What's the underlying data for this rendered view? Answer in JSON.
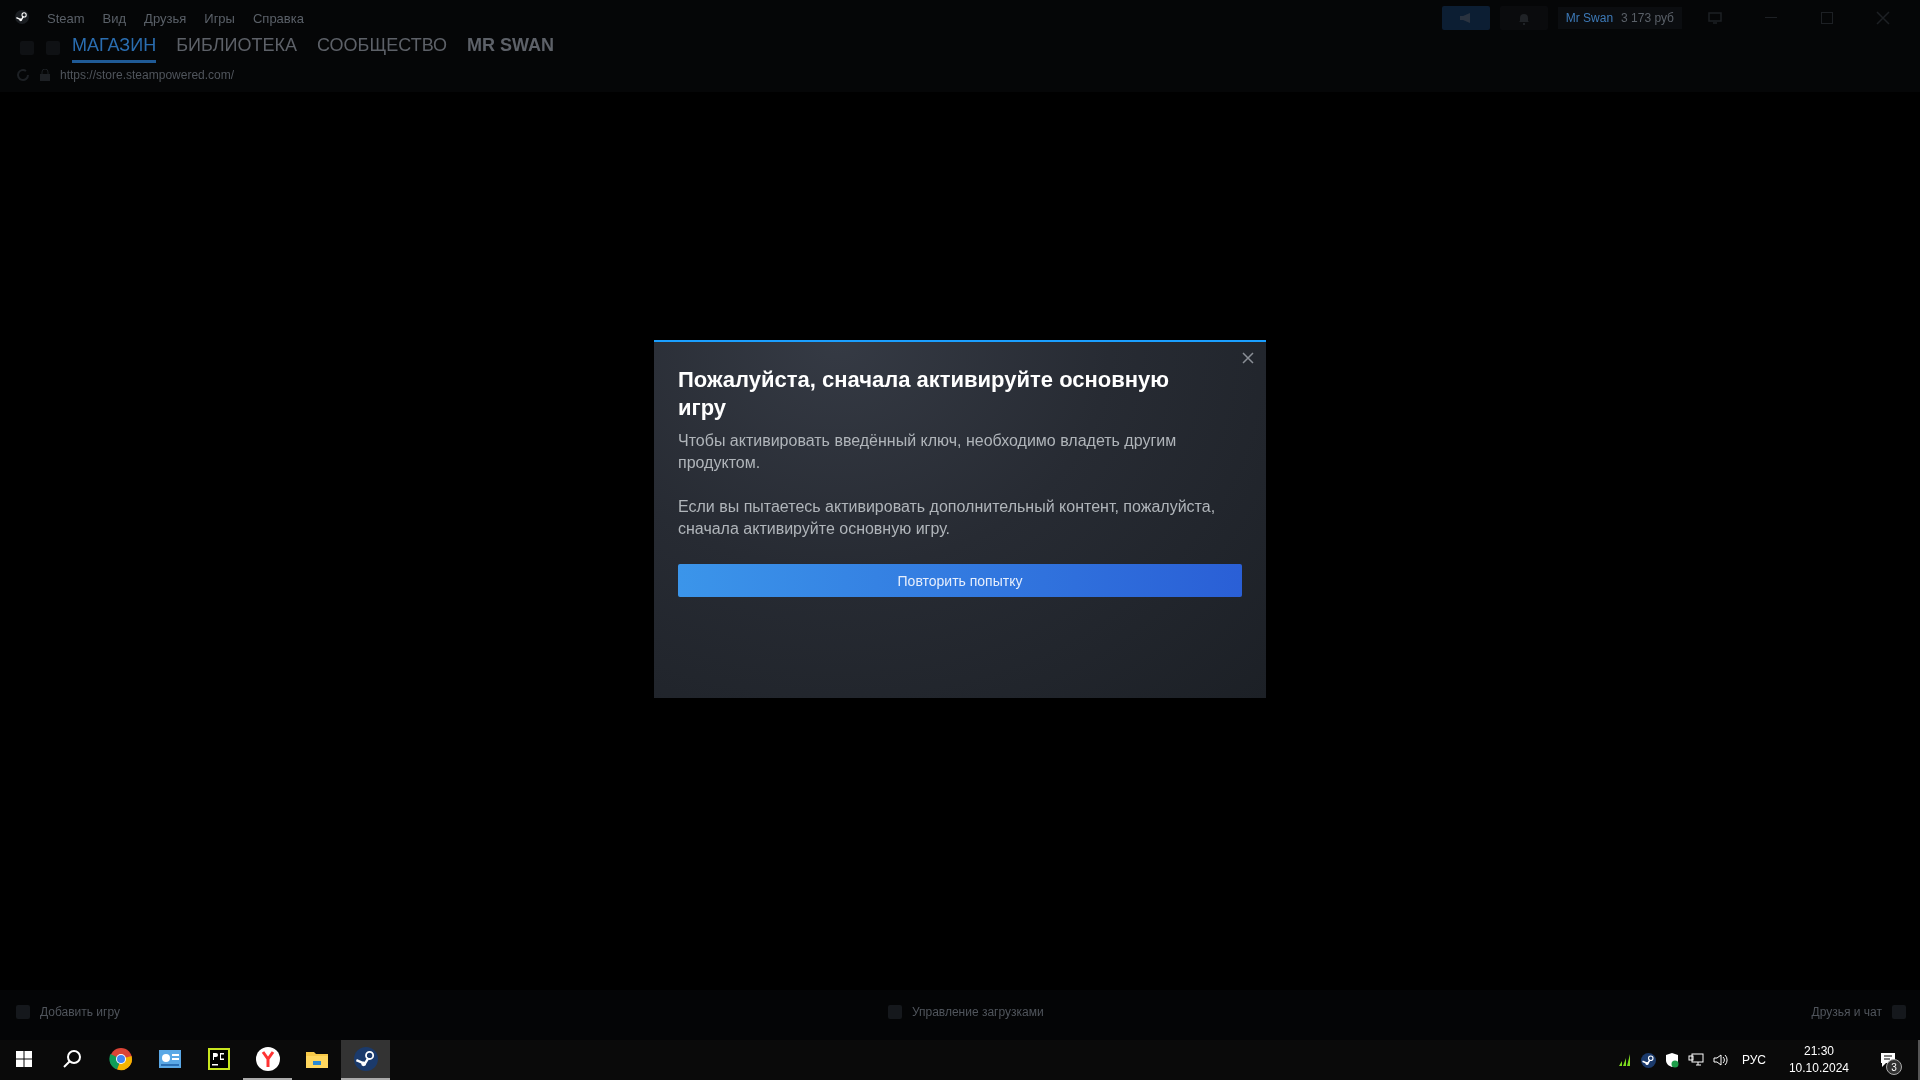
{
  "menu": [
    "Steam",
    "Вид",
    "Друзья",
    "Игры",
    "Справка"
  ],
  "tabs": [
    {
      "label": "МАГАЗИН",
      "selected": true
    },
    {
      "label": "БИБЛИОТЕКА",
      "selected": false
    },
    {
      "label": "СООБЩЕСТВО",
      "selected": false
    },
    {
      "label": "MR SWAN",
      "selected": false
    }
  ],
  "url": "https://store.steampowered.com/",
  "account": {
    "name": "Mr Swan",
    "balance": "3 173 руб"
  },
  "dialog": {
    "title": "Пожалуйста, сначала активируйте основную игру",
    "paragraphs": [
      "Чтобы активировать введённый ключ, необходимо владеть другим продуктом.",
      "Если вы пытаетесь активировать дополнительный контент, пожалуйста, сначала активируйте основную игру."
    ],
    "button": "Повторить попытку"
  },
  "footer": {
    "add_game": "Добавить игру",
    "downloads": "Управление загрузками",
    "friends": "Друзья и чат"
  },
  "taskbar": {
    "apps": [
      {
        "kind": "browser",
        "running": false,
        "selected": false
      },
      {
        "kind": "dashboard",
        "running": false,
        "selected": false
      },
      {
        "kind": "ide",
        "running": false,
        "selected": false
      },
      {
        "kind": "letter",
        "running": true,
        "selected": false
      },
      {
        "kind": "folder",
        "running": false,
        "selected": false
      },
      {
        "kind": "steam",
        "running": true,
        "selected": true
      }
    ],
    "language": "РУС",
    "time": "21:30",
    "date": "10.10.2024",
    "notifications": "3"
  }
}
